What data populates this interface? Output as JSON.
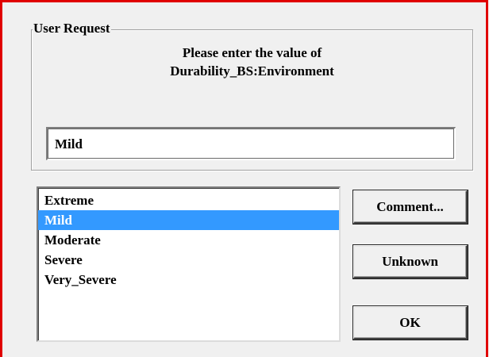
{
  "dialog": {
    "group_title": "User Request",
    "prompt_line1": "Please enter the value of",
    "prompt_line2": "Durability_BS:Environment",
    "input_value": "Mild"
  },
  "options": [
    {
      "label": "Extreme",
      "selected": false
    },
    {
      "label": "Mild",
      "selected": true
    },
    {
      "label": "Moderate",
      "selected": false
    },
    {
      "label": "Severe",
      "selected": false
    },
    {
      "label": "Very_Severe",
      "selected": false
    }
  ],
  "buttons": {
    "comment": "Comment...",
    "unknown": "Unknown",
    "ok": "OK"
  },
  "colors": {
    "selection": "#3399ff",
    "window_border": "#e00000",
    "background": "#f0f0f0"
  }
}
